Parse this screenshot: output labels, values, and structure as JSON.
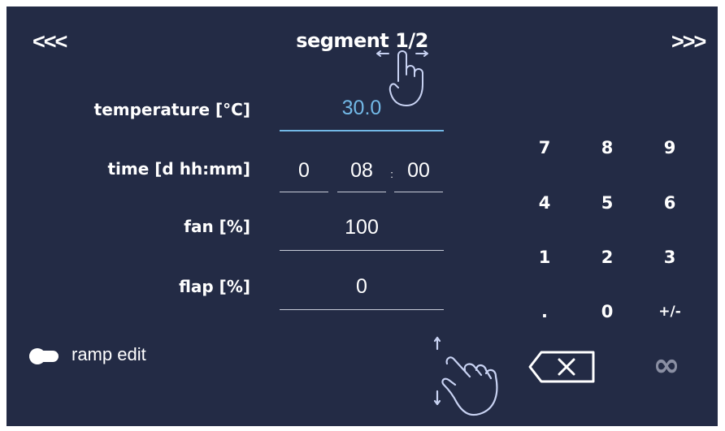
{
  "colors": {
    "panel": "#232b45",
    "active_value": "#72b8e6",
    "icon_stroke": "#c8d2f2",
    "disabled": "#8a8fa3"
  },
  "header": {
    "prev_label": "<<<",
    "title": "segment 1/2",
    "next_label": ">>>"
  },
  "fields": {
    "temperature": {
      "label": "temperature [°C]",
      "value": "30.0"
    },
    "time": {
      "label": "time [d hh:mm]",
      "days": "0",
      "hours": "08",
      "separator": ":",
      "minutes": "00"
    },
    "fan": {
      "label": "fan [%]",
      "value": "100"
    },
    "flap": {
      "label": "flap [%]",
      "value": "0"
    }
  },
  "keypad": {
    "keys": [
      "7",
      "8",
      "9",
      "4",
      "5",
      "6",
      "1",
      "2",
      "3",
      ".",
      "0",
      "+/-"
    ],
    "backspace_icon": "backspace-icon",
    "infinity_label": "∞"
  },
  "ramp_toggle": {
    "label": "ramp edit",
    "checked": false
  },
  "hints": {
    "swipe_horizontal_icon": "swipe-horizontal-hand-icon",
    "swipe_vertical_icon": "swipe-vertical-hand-icon"
  }
}
